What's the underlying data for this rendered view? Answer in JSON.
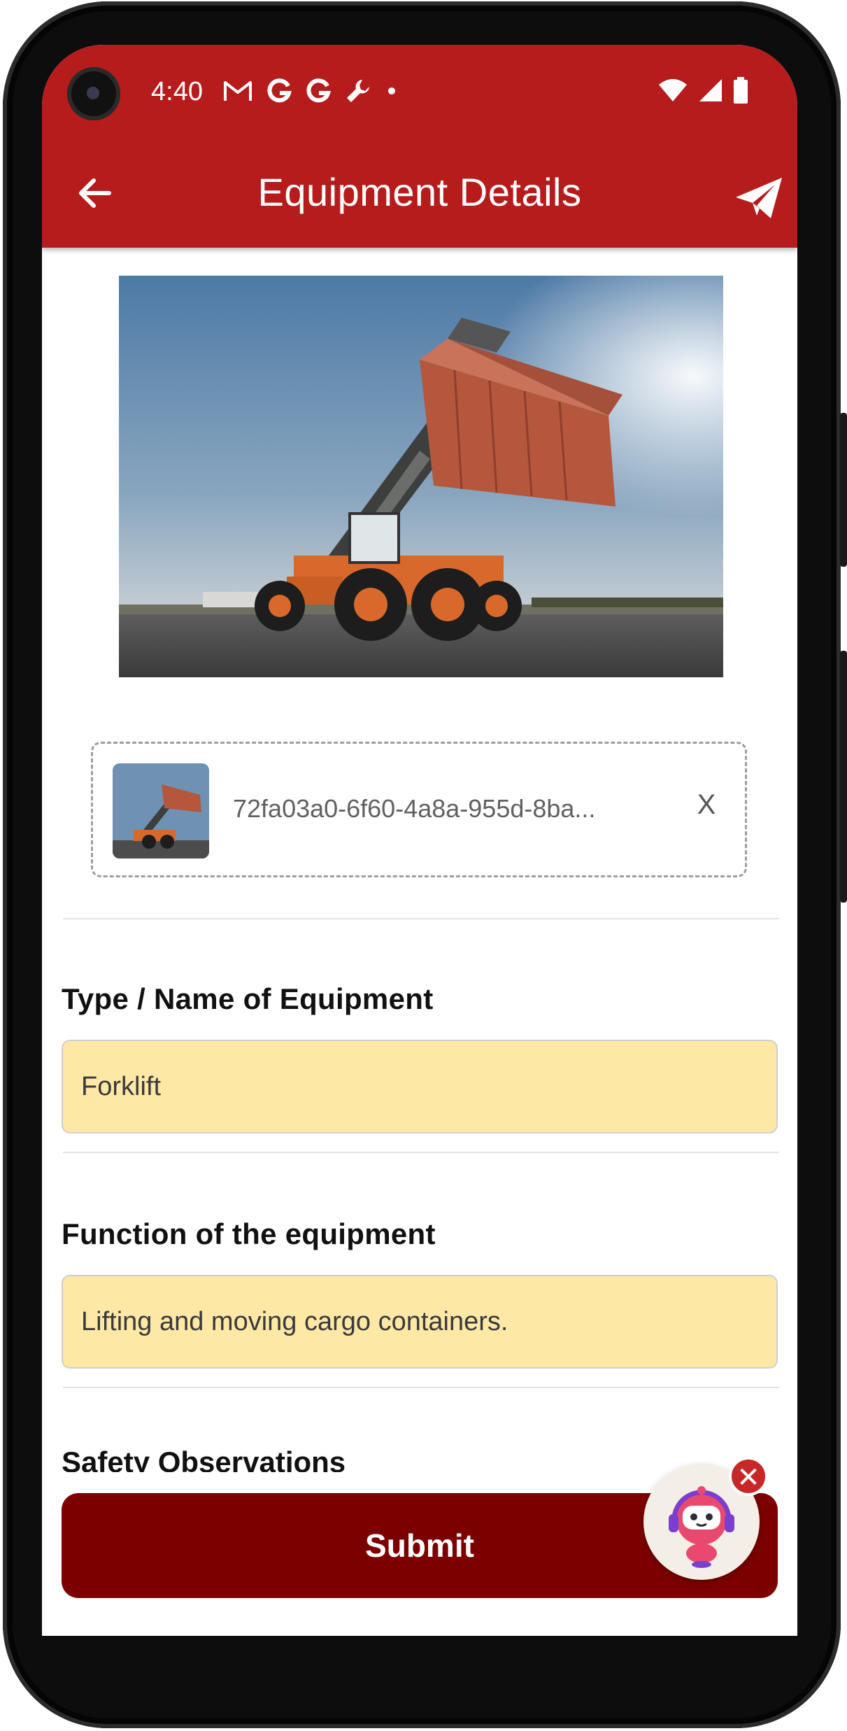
{
  "status_bar": {
    "time": "4:40",
    "notification_icons": [
      "gmail-icon",
      "google-icon",
      "google-icon",
      "wrench-icon",
      "dot-icon"
    ],
    "right_icons": [
      "wifi-icon",
      "signal-icon",
      "battery-icon"
    ]
  },
  "app_bar": {
    "title": "Equipment Details",
    "back_icon": "arrow-left-icon",
    "action_icon": "paper-plane-icon"
  },
  "attachment": {
    "file_name": "72fa03a0-6f60-4a8a-955d-8ba...",
    "remove_label": "X"
  },
  "form": {
    "fields": [
      {
        "label": "Type / Name of Equipment",
        "value": "Forklift"
      },
      {
        "label": "Function of the equipment",
        "value": "Lifting and moving cargo containers."
      }
    ],
    "next_label_partial": "Safety Observations"
  },
  "submit": {
    "label": "Submit"
  },
  "bot": {
    "close_label": "✕"
  },
  "colors": {
    "app_bar": "#b71c1c",
    "submit": "#7d0000",
    "input_bg": "#fde8a6",
    "close_badge": "#c62828"
  }
}
